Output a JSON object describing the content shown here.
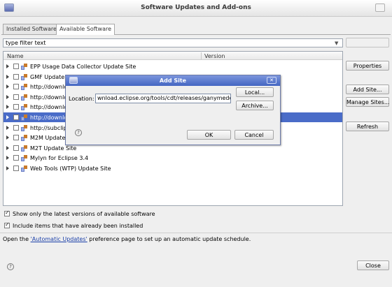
{
  "window": {
    "title": "Software Updates and Add-ons"
  },
  "tabs": [
    {
      "label": "Installed Software",
      "active": false
    },
    {
      "label": "Available Software",
      "active": true
    }
  ],
  "filter": {
    "value": "type filter text"
  },
  "table": {
    "headers": [
      "Name",
      "Version"
    ],
    "rows": [
      {
        "label": "EPP Usage Data Collector Update Site",
        "selected": false
      },
      {
        "label": "GMF Update S",
        "selected": false
      },
      {
        "label": "http://downlo",
        "selected": false
      },
      {
        "label": "http://downlo",
        "selected": false
      },
      {
        "label": "http://downlo",
        "selected": false
      },
      {
        "label": "http://downlo",
        "selected": true
      },
      {
        "label": "http://subclip",
        "selected": false
      },
      {
        "label": "M2M Update",
        "selected": false
      },
      {
        "label": "M2T Update Site",
        "selected": false
      },
      {
        "label": "Mylyn for Eclipse 3.4",
        "selected": false
      },
      {
        "label": "Web Tools (WTP) Update Site",
        "selected": false
      }
    ]
  },
  "side_buttons": {
    "properties": "Properties",
    "add_site": "Add Site...",
    "manage_sites": "Manage Sites...",
    "refresh": "Refresh"
  },
  "options": {
    "latest_only": "Show only the latest versions of available software",
    "include_installed": "Include items that have already been installed"
  },
  "info": {
    "prefix": "Open the ",
    "link": "'Automatic Updates'",
    "suffix": " preference page to set up an automatic update schedule."
  },
  "footer": {
    "close_label": "Close",
    "help_glyph": "?"
  },
  "dialog": {
    "title": "Add Site",
    "close_glyph": "✕",
    "location_label": "Location:",
    "location_value": "wnload.eclipse.org/tools/cdt/releases/ganymede",
    "local_label": "Local...",
    "archive_label": "Archive...",
    "ok_label": "OK",
    "cancel_label": "Cancel",
    "help_glyph": "?"
  },
  "colors": {
    "selection": "#4a6cc8",
    "dialog_title": "#4466c2",
    "link": "#1a3fa8"
  }
}
